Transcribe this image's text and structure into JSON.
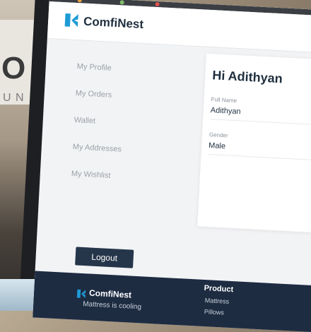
{
  "header": {
    "brand": "ComfiNest"
  },
  "sidebar": {
    "items": [
      {
        "label": "My Profile"
      },
      {
        "label": "My Orders"
      },
      {
        "label": "Wallet"
      },
      {
        "label": "My Addresses"
      },
      {
        "label": "My Wishlist"
      }
    ],
    "logout_label": "Logout"
  },
  "profile": {
    "greeting": "Hi Adithyan",
    "fields": [
      {
        "label": "Full Name",
        "value": "Adithyan"
      },
      {
        "label": "Gender",
        "value": "Male"
      }
    ]
  },
  "footer": {
    "brand": "ComfiNest",
    "tagline": "Mattress is cooling",
    "product_heading": "Product",
    "product_links": [
      "Mattress",
      "Pillows"
    ]
  },
  "colors": {
    "brand": "#1f2f3f",
    "accent": "#1d9bd7",
    "logout_bg": "#26364a",
    "footer_bg": "#1e2c42"
  }
}
